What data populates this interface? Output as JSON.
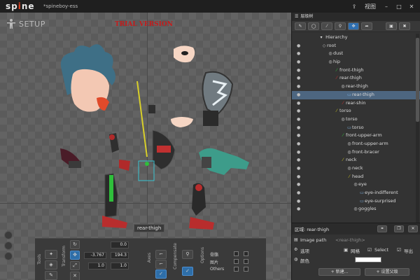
{
  "app": {
    "logo": "sp",
    "logo_dot": "i",
    "logo_rest": "ne",
    "document_title": "*spineboy-ess",
    "view_menu": "视图"
  },
  "viewport": {
    "mode_label": "SETUP",
    "trial_label": "TRIAL VERSION",
    "bone_tooltip": "rear-thigh"
  },
  "toolbar": {
    "tools_label": "Tools",
    "transform_label": "Transform",
    "axes_label": "Axes",
    "compensate_label": "Compensate",
    "options_label": "Options",
    "rotate_value": "0.0",
    "translate_x": "-3.767",
    "translate_y": "194.3",
    "scale_x": "1.0",
    "scale_y": "1.0",
    "options": [
      "骨骼",
      "图片",
      "Others"
    ]
  },
  "tree": {
    "tab_label": "层级树",
    "header": "Hierarchy",
    "rows": [
      {
        "label": "root",
        "indent": 0,
        "type": "root"
      },
      {
        "label": "dust",
        "indent": 1,
        "type": "slot"
      },
      {
        "label": "hip",
        "indent": 1,
        "type": "slot"
      },
      {
        "label": "front-thigh",
        "indent": 2,
        "type": "bone-green"
      },
      {
        "label": "rear-thigh",
        "indent": 2,
        "type": "bone-red"
      },
      {
        "label": "rear-thigh",
        "indent": 3,
        "type": "slot"
      },
      {
        "label": "rear-thigh",
        "indent": 4,
        "type": "image",
        "selected": true
      },
      {
        "label": "rear-shin",
        "indent": 3,
        "type": "bone-red"
      },
      {
        "label": "torso",
        "indent": 2,
        "type": "bone"
      },
      {
        "label": "torso",
        "indent": 3,
        "type": "slot"
      },
      {
        "label": "torso",
        "indent": 4,
        "type": "image"
      },
      {
        "label": "front-upper-arm",
        "indent": 3,
        "type": "bone-green"
      },
      {
        "label": "front-upper-arm",
        "indent": 4,
        "type": "slot"
      },
      {
        "label": "front-bracer",
        "indent": 4,
        "type": "slot"
      },
      {
        "label": "neck",
        "indent": 3,
        "type": "bone"
      },
      {
        "label": "neck",
        "indent": 4,
        "type": "slot"
      },
      {
        "label": "head",
        "indent": 4,
        "type": "bone"
      },
      {
        "label": "eye",
        "indent": 5,
        "type": "slot"
      },
      {
        "label": "eye-indifferent",
        "indent": 6,
        "type": "image"
      },
      {
        "label": "eye-surprised",
        "indent": 6,
        "type": "image"
      },
      {
        "label": "goggles",
        "indent": 5,
        "type": "slot"
      }
    ]
  },
  "properties": {
    "title": "区域: rear-thigh",
    "image_path_label": "Image path",
    "image_path_value": "<rear-thigh>",
    "options_label": "选项",
    "mesh_label": "网格",
    "select_label": "Select",
    "export_label": "导出",
    "color_label": "颜色",
    "new_button": "+ 新建...",
    "setup_parent_button": "+ 设置父级"
  },
  "colors": {
    "accent": "#2e6ea8",
    "trial": "#c41b1b",
    "selection": "#4d6680"
  }
}
